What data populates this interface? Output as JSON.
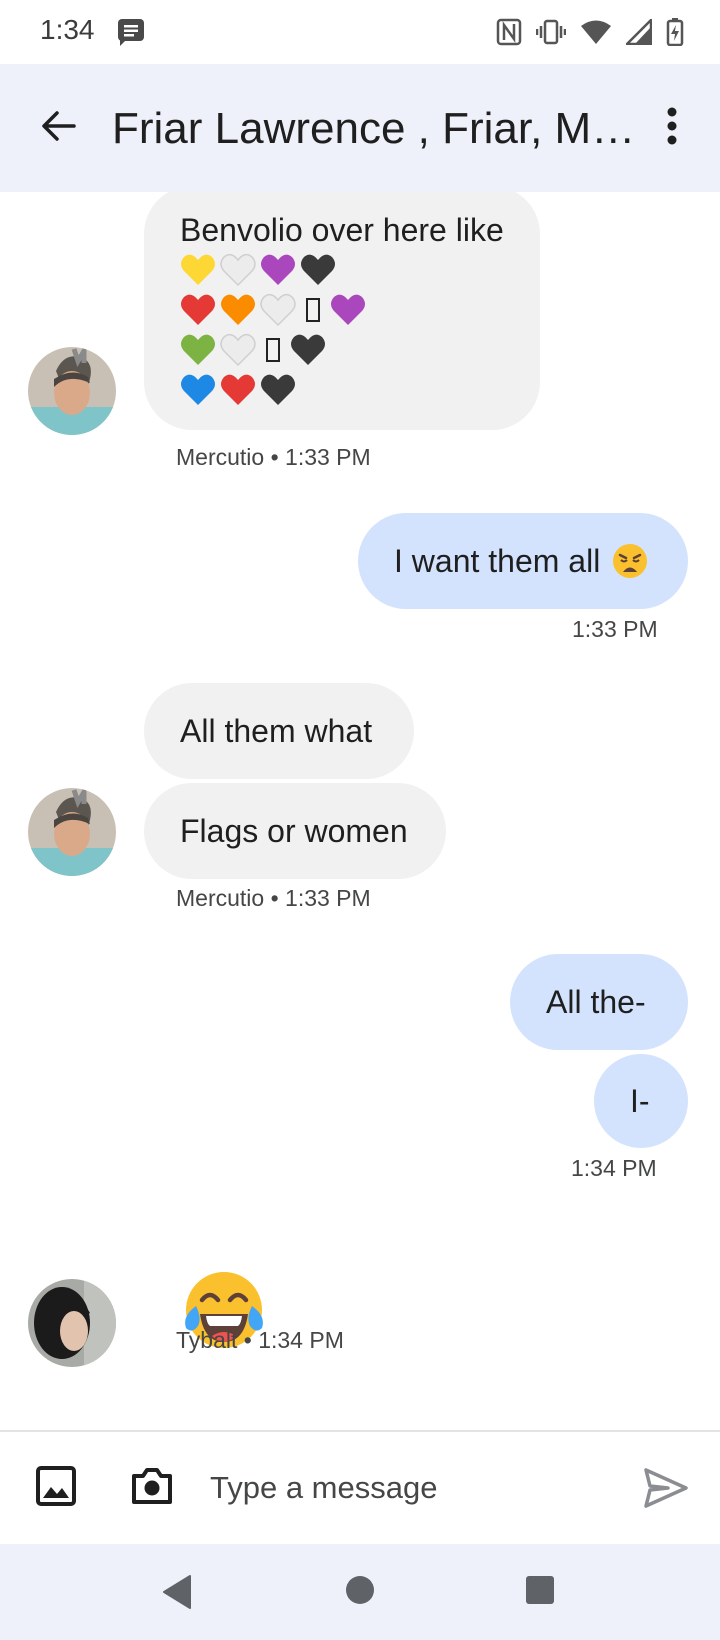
{
  "status_bar": {
    "time": "1:34",
    "icons": [
      "message-notification-icon",
      "nfc-icon",
      "vibrate-icon",
      "wifi-icon",
      "signal-icon",
      "battery-charging-icon"
    ]
  },
  "app_bar": {
    "title": "Friar Lawrence , Friar, Me...",
    "icons": [
      "back-arrow-icon",
      "more-vert-icon"
    ]
  },
  "messages": [
    {
      "direction": "incoming",
      "sender": "Mercutio",
      "text": "Benvolio over here like",
      "emoji_rows": [
        [
          "yellow-heart",
          "white-heart",
          "purple-heart",
          "black-heart"
        ],
        [
          "red-heart",
          "orange-heart",
          "white-heart",
          "missing-glyph",
          "purple-heart"
        ],
        [
          "green-heart",
          "white-heart",
          "missing-glyph",
          "black-heart"
        ],
        [
          "blue-heart",
          "red-heart",
          "black-heart"
        ]
      ],
      "meta": "Mercutio • 1:33 PM"
    },
    {
      "direction": "outgoing",
      "text": "I want them all",
      "emoji": "weary-face",
      "meta": "1:33 PM"
    },
    {
      "direction": "incoming",
      "sender": "Mercutio",
      "texts": [
        "All them what",
        "Flags or women"
      ],
      "meta": "Mercutio • 1:33 PM"
    },
    {
      "direction": "outgoing",
      "texts": [
        "All the-",
        "I-"
      ],
      "meta": "1:34 PM"
    },
    {
      "direction": "incoming",
      "sender": "Tybalt",
      "emoji": "face-with-tears-of-joy",
      "meta": "Tybalt • 1:34 PM"
    }
  ],
  "emoji_colors": {
    "yellow-heart": "#fdd835",
    "white-heart": "#eeeeee",
    "purple-heart": "#ab47bc",
    "black-heart": "#3a3a3a",
    "red-heart": "#e53935",
    "orange-heart": "#fb8c00",
    "green-heart": "#7cb342",
    "blue-heart": "#1e88e5"
  },
  "composer": {
    "placeholder": "Type a message",
    "icons": [
      "gallery-icon",
      "camera-icon",
      "send-icon"
    ]
  },
  "nav_bar": {
    "icons": [
      "back-triangle-icon",
      "home-circle-icon",
      "recents-square-icon"
    ]
  },
  "colors": {
    "app_bar_bg": "#eef1fa",
    "incoming_bubble": "#f1f1f1",
    "outgoing_bubble": "#d3e3fd",
    "meta_text": "#444746"
  }
}
